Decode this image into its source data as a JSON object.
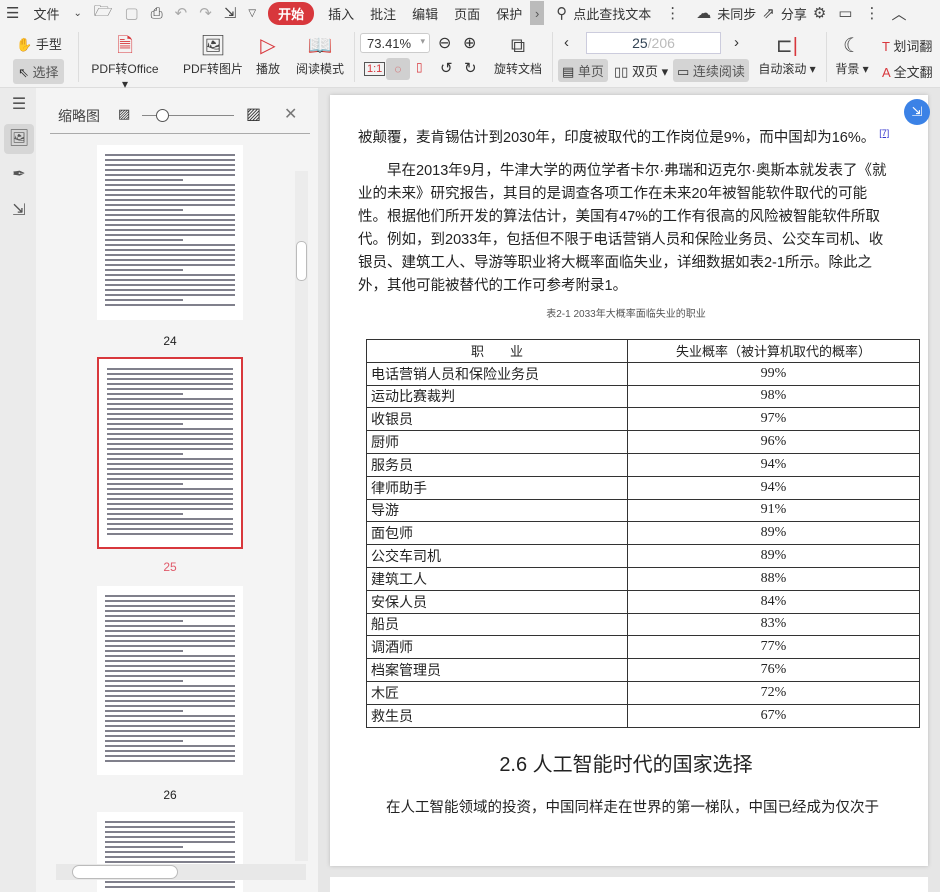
{
  "menubar": {
    "file": "文件",
    "tabs": [
      "开始",
      "插入",
      "批注",
      "编辑",
      "页面",
      "保护"
    ],
    "search": "点此查找文本",
    "sync": "未同步",
    "share": "分享"
  },
  "toolbar": {
    "hand": "手型",
    "select": "选择",
    "pdf_office": "PDF转Office",
    "pdf_image": "PDF转图片",
    "play": "播放",
    "read_mode": "阅读模式",
    "zoom": "73.41%",
    "rotate": "旋转文档",
    "page_current": "25",
    "page_total": "/206",
    "single": "单页",
    "double": "双页",
    "continuous": "连续阅读",
    "auto_scroll": "自动滚动",
    "background": "背景",
    "word_translate": "划词翻",
    "full_translate": "全文翻"
  },
  "sidebar": {
    "title": "缩略图",
    "pages": [
      "24",
      "25",
      "26"
    ],
    "selected": "25"
  },
  "document": {
    "line1": "被颠覆，麦肯锡估计到2030年，印度被取代的工作岗位是9%，而中国却为16%。",
    "footnote": "[7]",
    "para": "早在2013年9月，牛津大学的两位学者卡尔·弗瑞和迈克尔·奥斯本就发表了《就业的未来》研究报告，其目的是调查各项工作在未来20年被智能软件取代的可能性。根据他们所开发的算法估计，美国有47%的工作有很高的风险被智能软件所取代。例如，到2033年，包括但不限于电话营销人员和保险业务员、公交车司机、收银员、建筑工人、导游等职业将大概率面临失业，详细数据如表2-1所示。除此之外，其他可能被替代的工作可参考附录1。",
    "table_caption": "表2-1 2033年大概率面临失业的职业",
    "table_headers": [
      "职　　业",
      "失业概率（被计算机取代的概率）"
    ],
    "table_rows": [
      [
        "电话营销人员和保险业务员",
        "99%"
      ],
      [
        "运动比赛裁判",
        "98%"
      ],
      [
        "收银员",
        "97%"
      ],
      [
        "厨师",
        "96%"
      ],
      [
        "服务员",
        "94%"
      ],
      [
        "律师助手",
        "94%"
      ],
      [
        "导游",
        "91%"
      ],
      [
        "面包师",
        "89%"
      ],
      [
        "公交车司机",
        "89%"
      ],
      [
        "建筑工人",
        "88%"
      ],
      [
        "安保人员",
        "84%"
      ],
      [
        "船员",
        "83%"
      ],
      [
        "调酒师",
        "77%"
      ],
      [
        "档案管理员",
        "76%"
      ],
      [
        "木匠",
        "72%"
      ],
      [
        "救生员",
        "67%"
      ]
    ],
    "heading": "2.6  人工智能时代的国家选择",
    "last_para": "在人工智能领域的投资，中国同样走在世界的第一梯队，中国已经成为仅次于"
  },
  "colors": {
    "accent": "#d8373c",
    "float_btn": "#3b82e6"
  }
}
